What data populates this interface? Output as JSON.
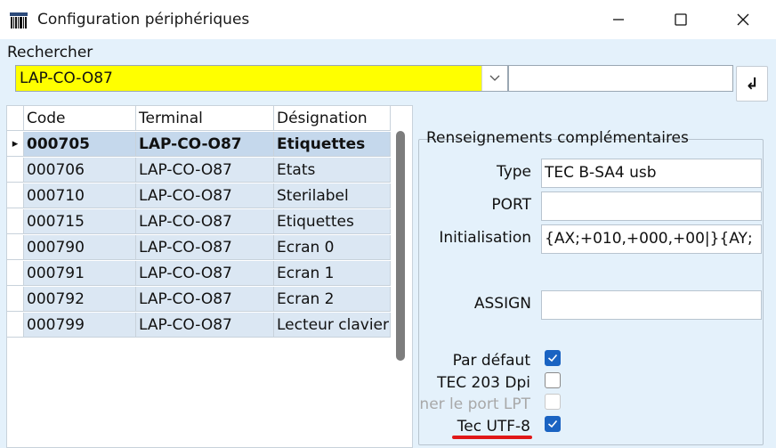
{
  "window": {
    "title": "Configuration périphériques",
    "controls": {
      "minimize": "minimize-icon",
      "maximize": "maximize-icon",
      "close": "close-icon"
    }
  },
  "search": {
    "label": "Rechercher",
    "value": "LAP-CO-O87",
    "highlight_color": "#ffff00",
    "extra_value": "",
    "enter_icon": "↲"
  },
  "grid": {
    "columns": [
      "Code",
      "Terminal",
      "Désignation"
    ],
    "selected_indicator": "▸",
    "rows": [
      {
        "code": "000705",
        "terminal": "LAP-CO-O87",
        "designation": "Etiquettes",
        "selected": true
      },
      {
        "code": "000706",
        "terminal": "LAP-CO-O87",
        "designation": "Etats"
      },
      {
        "code": "000710",
        "terminal": "LAP-CO-O87",
        "designation": "Sterilabel"
      },
      {
        "code": "000715",
        "terminal": "LAP-CO-O87",
        "designation": "Etiquettes"
      },
      {
        "code": "000790",
        "terminal": "LAP-CO-O87",
        "designation": "Ecran 0"
      },
      {
        "code": "000791",
        "terminal": "LAP-CO-O87",
        "designation": "Ecran 1"
      },
      {
        "code": "000792",
        "terminal": "LAP-CO-O87",
        "designation": "Ecran 2"
      },
      {
        "code": "000799",
        "terminal": "LAP-CO-O87",
        "designation": "Lecteur clavier"
      }
    ]
  },
  "details": {
    "group_title": "Renseignements complémentaires",
    "type_label": "Type",
    "type_value": "TEC B-SA4 usb",
    "port_label": "PORT",
    "port_value": "",
    "init_label": "Initialisation",
    "init_value": "{AX;+010,+000,+00|}{AY;",
    "assign_label": "ASSIGN",
    "assign_value": "",
    "checkboxes": [
      {
        "label": "Par défaut",
        "checked": true,
        "enabled": true
      },
      {
        "label": "TEC 203 Dpi",
        "checked": false,
        "enabled": true
      },
      {
        "label": "ner le port LPT",
        "checked": false,
        "enabled": false
      },
      {
        "label": "Tec UTF-8",
        "checked": true,
        "enabled": true
      }
    ],
    "annotation_color": "#e01818"
  }
}
